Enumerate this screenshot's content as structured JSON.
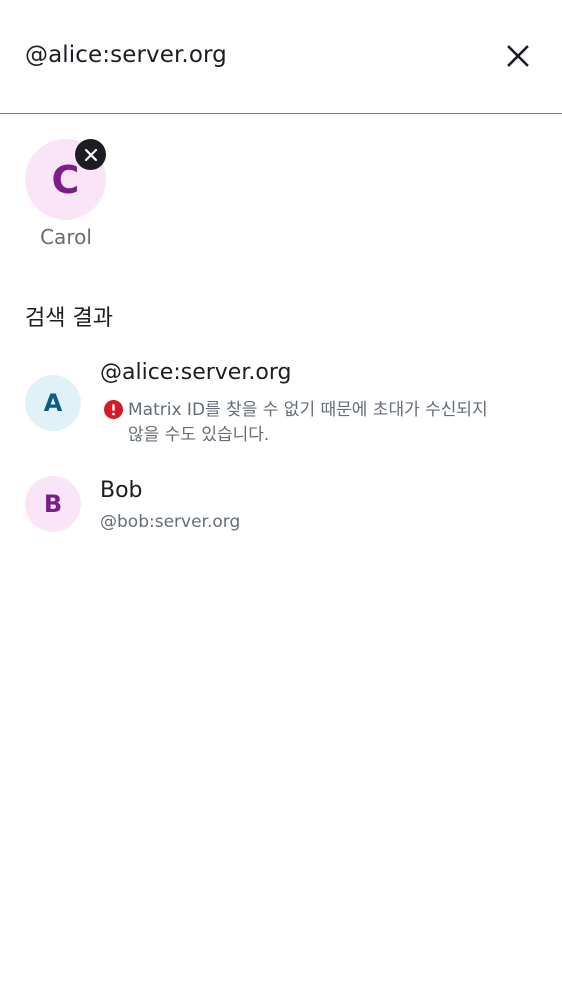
{
  "search": {
    "query": "@alice:server.org",
    "close_icon": "close-icon"
  },
  "selected_users": [
    {
      "initial": "C",
      "name": "Carol",
      "avatar_bg": "#fae5f8",
      "avatar_fg": "#7c1d8a"
    }
  ],
  "results": {
    "title": "검색 결과",
    "items": [
      {
        "initial": "A",
        "name": "@alice:server.org",
        "warning": "Matrix ID를 찾을 수 없기 때문에 초대가 수신되지 않을 수도 있습니다.",
        "avatar_bg": "#e0f2f8",
        "avatar_fg": "#0e5b85"
      },
      {
        "initial": "B",
        "name": "Bob",
        "subtitle": "@bob:server.org",
        "avatar_bg": "#fae5f8",
        "avatar_fg": "#7c1d8a"
      }
    ]
  },
  "colors": {
    "error": "#d51928",
    "secondary_text": "#656d77",
    "primary_text": "#1b1d22"
  }
}
